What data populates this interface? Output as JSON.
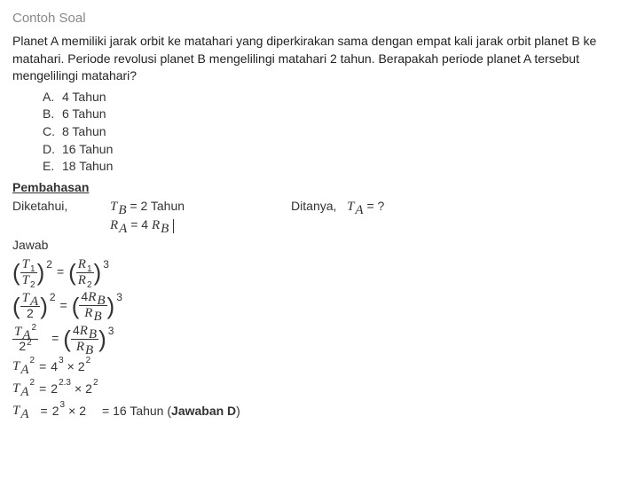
{
  "title": "Contoh Soal",
  "question": "Planet A memiliki jarak orbit ke matahari yang diperkirakan sama dengan empat kali jarak orbit planet B ke matahari. Periode revolusi planet B mengelilingi matahari 2 tahun. Berapakah periode planet A tersebut mengelilingi matahari?",
  "options": [
    {
      "letter": "A.",
      "text": "4 Tahun"
    },
    {
      "letter": "B.",
      "text": "6 Tahun"
    },
    {
      "letter": "C.",
      "text": "8 Tahun"
    },
    {
      "letter": "D.",
      "text": "16 Tahun"
    },
    {
      "letter": "E.",
      "text": "18 Tahun"
    }
  ],
  "labels": {
    "pembahasan": "Pembahasan",
    "diketahui": "Diketahui,",
    "ditanya": "Ditanya,",
    "jawab": "Jawab"
  },
  "known": {
    "tb": "= 2 Tahun",
    "ra": "= 4",
    "ask_eq": " = ?"
  },
  "final": {
    "value": "= 16 Tahun (",
    "answer": "Jawaban D",
    "close": ")"
  },
  "sym": {
    "T": "T",
    "R": "R",
    "A": "A",
    "B": "B",
    "1": "1",
    "2": "2",
    "3": "3",
    "4": "4",
    "two": "2",
    "p23": "2.3",
    "eq": "=",
    "times": "×",
    "lp": "(",
    "rp": ")"
  }
}
